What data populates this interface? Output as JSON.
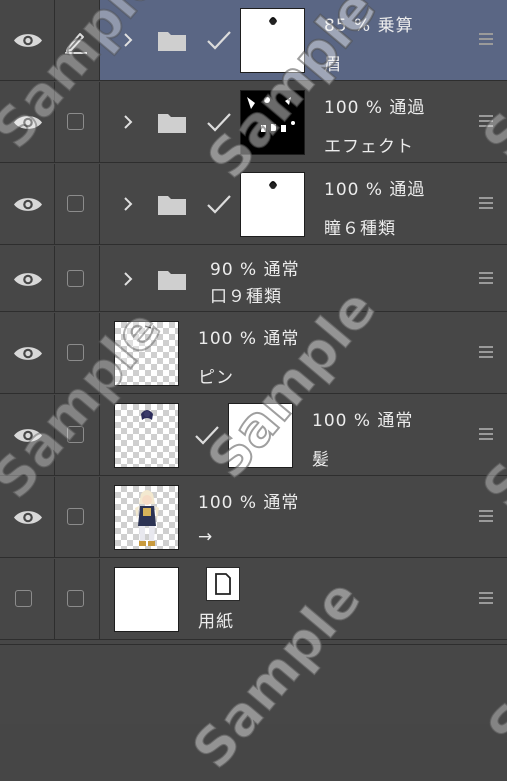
{
  "layers": [
    {
      "opacity": "85 %",
      "blend": "乗算",
      "name": "眉",
      "folder": true,
      "clip": true,
      "thumb": "white-hair",
      "selected": true,
      "edit": true,
      "visible": true
    },
    {
      "opacity": "100 %",
      "blend": "通過",
      "name": "エフェクト",
      "folder": true,
      "clip": true,
      "thumb": "black-effect",
      "selected": false,
      "edit": false,
      "visible": true
    },
    {
      "opacity": "100 %",
      "blend": "通過",
      "name": "瞳６種類",
      "folder": true,
      "clip": true,
      "thumb": "white-hair",
      "selected": false,
      "edit": false,
      "visible": true
    },
    {
      "opacity": "90 %",
      "blend": "通常",
      "name": "口９種類",
      "folder": true,
      "clip": false,
      "thumb": "none",
      "selected": false,
      "edit": false,
      "visible": true
    },
    {
      "opacity": "100 %",
      "blend": "通常",
      "name": "ピン",
      "folder": false,
      "clip": false,
      "thumb": "checker",
      "selected": false,
      "edit": false,
      "visible": true
    },
    {
      "opacity": "100 %",
      "blend": "通常",
      "name": "髪",
      "folder": false,
      "clip": true,
      "thumb": "checker-mask",
      "selected": false,
      "edit": false,
      "visible": true
    },
    {
      "opacity": "100 %",
      "blend": "通常",
      "name": "→",
      "folder": false,
      "clip": false,
      "thumb": "checker-figure",
      "selected": false,
      "edit": false,
      "visible": true
    },
    {
      "opacity": "",
      "blend": "",
      "name": "用紙",
      "folder": false,
      "clip": false,
      "thumb": "paper",
      "selected": false,
      "edit": false,
      "visible": false
    }
  ],
  "watermark": "Sample",
  "icons": {
    "visibility": "eye-icon",
    "edit": "pen-icon",
    "expand": "chevron-right-icon",
    "folder": "folder-icon",
    "clip": "checkmark-icon",
    "menu": "menu-icon",
    "paper": "paper-icon"
  },
  "colors": {
    "selected": "#5a6684",
    "panel": "#474747"
  }
}
